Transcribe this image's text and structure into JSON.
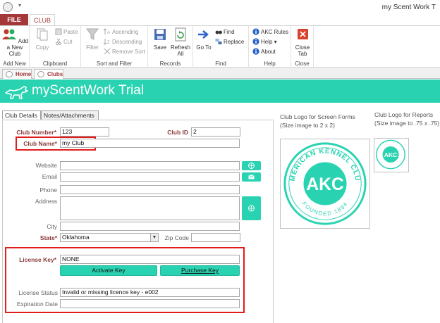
{
  "window": {
    "title": "my Scent Work T"
  },
  "ribbon_tabs": {
    "file": "FILE",
    "club": "CLUB"
  },
  "ribbon": {
    "add_new": {
      "button": "Add a New Club",
      "group": "Add New"
    },
    "clipboard": {
      "copy": "Copy",
      "paste": "Paste",
      "cut": "Cut",
      "group": "Clipboard"
    },
    "sort_filter": {
      "filter": "Filter",
      "ascending": "Ascending",
      "descending": "Descending",
      "remove_sort": "Remove Sort",
      "group": "Sort and Filter"
    },
    "records": {
      "save": "Save",
      "refresh_all": "Refresh All",
      "group": "Records"
    },
    "find": {
      "goto": "Go To",
      "find": "Find",
      "replace": "Replace",
      "group": "Find"
    },
    "help": {
      "akc_rules": "AKC Rules",
      "help": "Help",
      "about": "About",
      "group": "Help"
    },
    "close": {
      "close_tab": "Close Tab",
      "group": "Close"
    }
  },
  "doc_tabs": {
    "home": "Home",
    "clubs": "Clubs"
  },
  "banner": {
    "title": "myScentWork Trial"
  },
  "form_tabs": {
    "details": "Club Details",
    "notes": "Notes/Attachments"
  },
  "form": {
    "club_number": {
      "label": "Club Number*",
      "value": "123"
    },
    "club_id": {
      "label": "Club ID",
      "value": "2"
    },
    "club_name": {
      "label": "Club Name*",
      "value": "my Club"
    },
    "website": {
      "label": "Website",
      "value": ""
    },
    "email": {
      "label": "Email",
      "value": ""
    },
    "phone": {
      "label": "Phone",
      "value": ""
    },
    "address": {
      "label": "Address",
      "value": ""
    },
    "city": {
      "label": "City",
      "value": ""
    },
    "state": {
      "label": "State*",
      "value": "Oklahoma"
    },
    "zip": {
      "label": "Zip Code",
      "value": ""
    },
    "license_key": {
      "label": "License Key*",
      "value": "NONE"
    },
    "activate_key": "Activate Key",
    "purchase_key": "Purchase Key",
    "license_status": {
      "label": "License Status",
      "value": "Invalid or missing licence key - e002"
    },
    "expiration_date": {
      "label": "Expiration Date",
      "value": ""
    }
  },
  "logos": {
    "screen_caption": "Club Logo for Screen Forms (Size image to 2 x 2)",
    "reports_caption": "Club Logo for Reports (Size image to .75 x .75)",
    "akc_top": "AMERICAN KENNEL CLUB",
    "akc_center": "AKC",
    "akc_bottom": "FOUNDED 1884"
  },
  "colors": {
    "accent": "#29d3b1",
    "brand": "#a4373a",
    "highlight": "#e21b1b"
  }
}
